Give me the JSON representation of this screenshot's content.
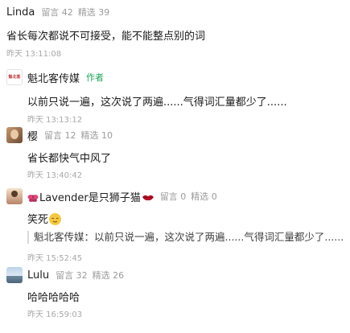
{
  "comments": [
    {
      "name": "Linda",
      "likes_label": "留言 42",
      "featured_label": "精选 39",
      "content": "省长每次都说不可接受，能不能整点别的词",
      "time": "昨天 13:11:08"
    },
    {
      "avatar_text": "魁北客",
      "name": "魁北客传媒",
      "badge": "作者",
      "content": "以前只说一遍，这次说了两遍......气得词汇量都少了......",
      "time": "昨天 13:13:12"
    },
    {
      "name": "樱",
      "likes_label": "留言 12",
      "featured_label": "精选 10",
      "content": "省长都快气中风了",
      "time": "昨天 13:40:42"
    },
    {
      "name": "Lavender是只狮子猫",
      "likes_label": "留言 0",
      "featured_label": "精选 0",
      "content": "笑死",
      "reply": "魁北客传媒：以前只说一遍，这次说了两遍......气得词汇量都少了......",
      "time": "昨天 15:52:45"
    },
    {
      "name": "Lulu",
      "likes_label": "留言 32",
      "featured_label": "精选 26",
      "content": "哈哈哈哈哈",
      "time": "昨天 16:59:03"
    }
  ],
  "colors": {
    "author_badge": "#21a45a",
    "meta_text": "#9b9b9b"
  }
}
